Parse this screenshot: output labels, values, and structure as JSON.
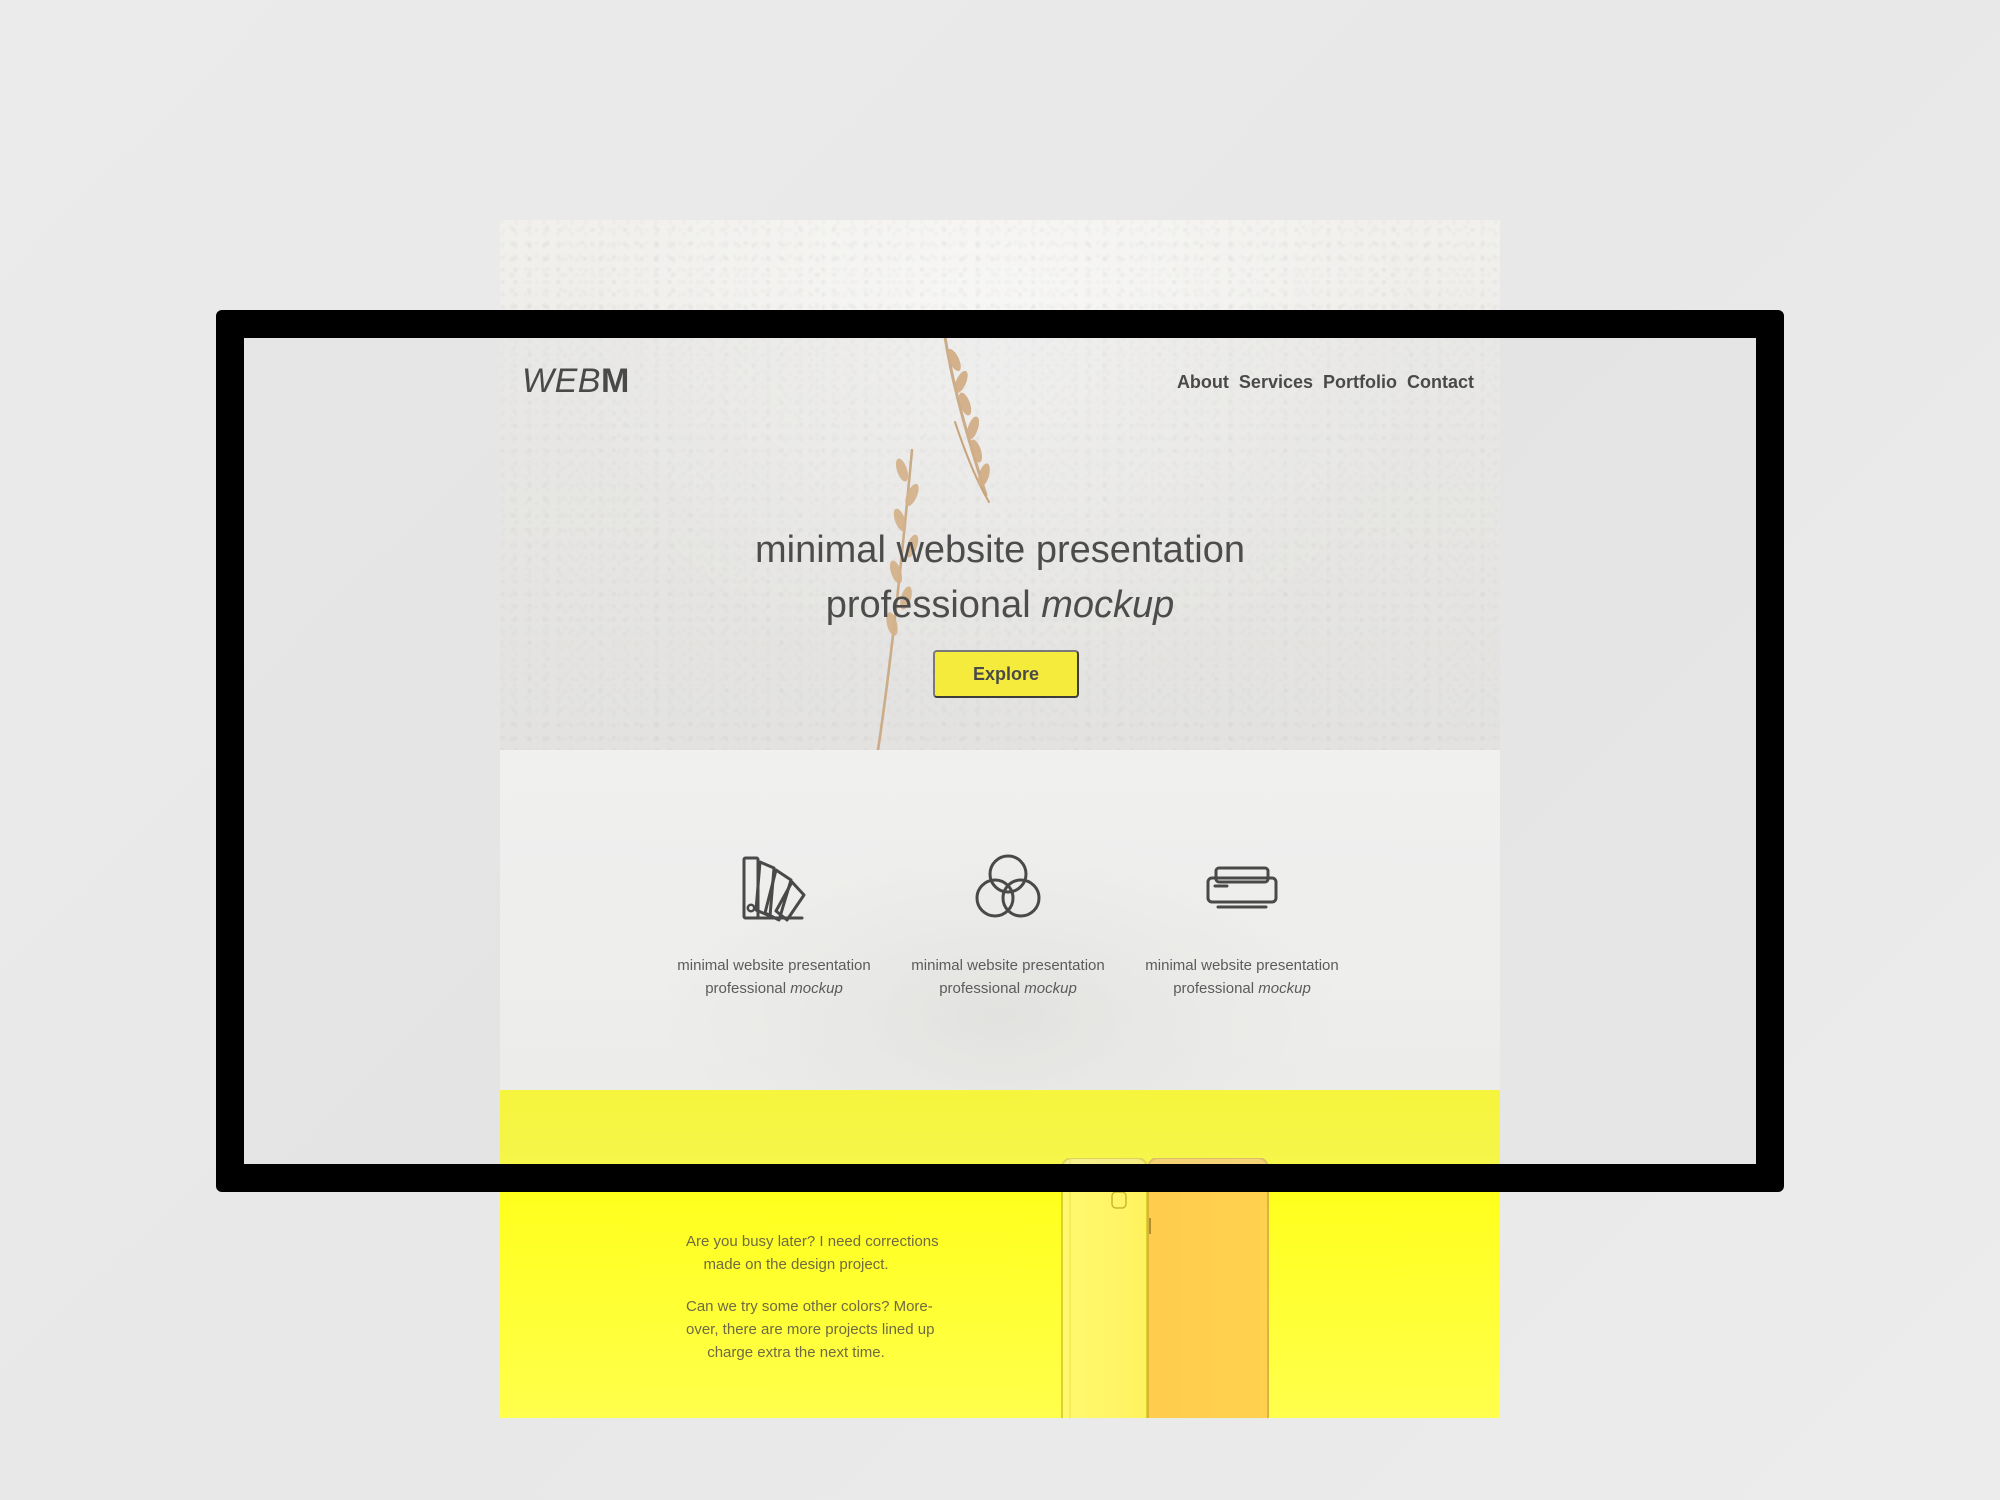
{
  "site": {
    "logo_light": "WEB",
    "logo_bold": "M",
    "nav": [
      "About",
      "Services",
      "Portfolio",
      "Contact"
    ]
  },
  "hero": {
    "line1": "minimal website presentation",
    "line2_prefix": "professional ",
    "line2_accent": "mockup",
    "cta": "Explore"
  },
  "services": [
    {
      "icon": "color-swatch-icon",
      "line1": "minimal website presentation",
      "line2_prefix": "professional ",
      "line2_accent": "mockup"
    },
    {
      "icon": "color-circles-icon",
      "line1": "minimal website presentation",
      "line2_prefix": "professional ",
      "line2_accent": "mockup"
    },
    {
      "icon": "printer-icon",
      "line1": "minimal website presentation",
      "line2_prefix": "professional ",
      "line2_accent": "mockup"
    }
  ],
  "promo": {
    "paragraph1": [
      "Are you busy later? I need corrections",
      "made on the design project."
    ],
    "paragraph2": [
      "Can we try some other colors? More-",
      "over, there are more projects lined up",
      "charge extra the next time."
    ]
  },
  "colors": {
    "accent": "#fff200",
    "text": "#111111",
    "monitor_frame": "#000000"
  }
}
